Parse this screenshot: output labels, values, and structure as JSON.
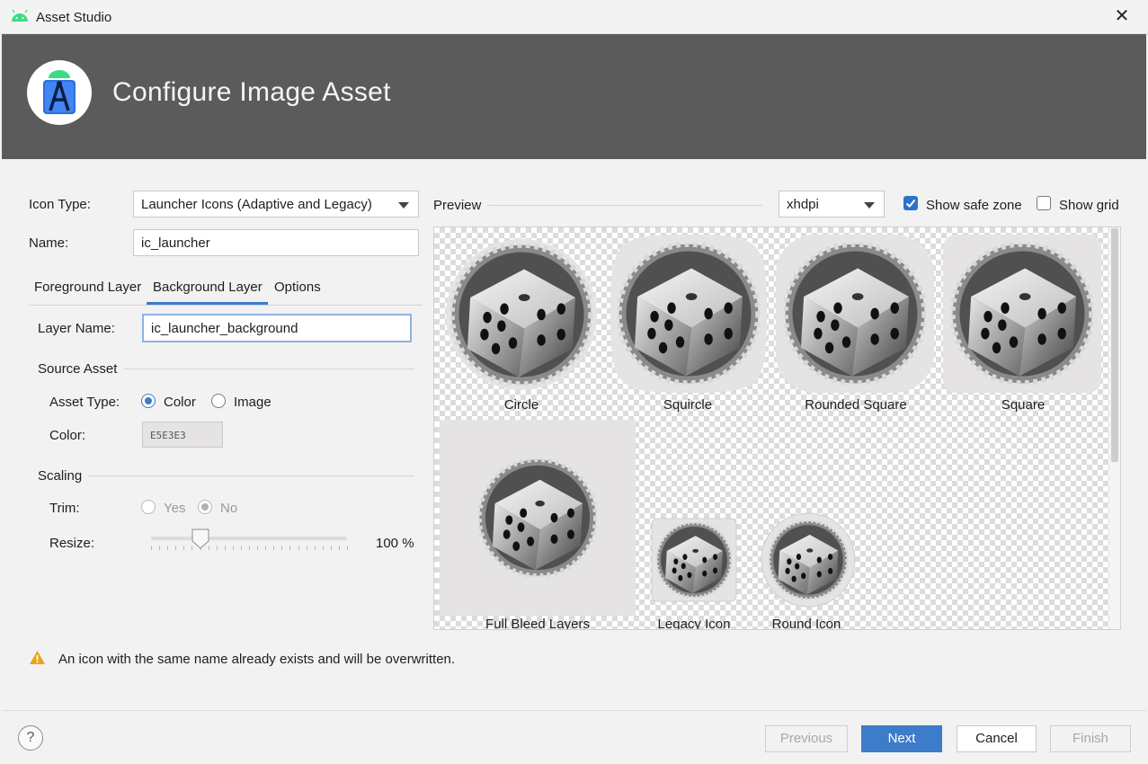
{
  "window": {
    "title": "Asset Studio",
    "close_symbol": "✕"
  },
  "header": {
    "title": "Configure Image Asset"
  },
  "form": {
    "icon_type_label": "Icon Type:",
    "icon_type_value": "Launcher Icons (Adaptive and Legacy)",
    "name_label": "Name:",
    "name_value": "ic_launcher",
    "tabs": [
      "Foreground Layer",
      "Background Layer",
      "Options"
    ],
    "active_tab": "Background Layer",
    "layer_name_label": "Layer Name:",
    "layer_name_value": "ic_launcher_background",
    "source_asset_heading": "Source Asset",
    "asset_type_label": "Asset Type:",
    "asset_type_options": [
      "Color",
      "Image"
    ],
    "asset_type_selected": "Color",
    "color_label": "Color:",
    "color_value": "E5E3E3",
    "scaling_heading": "Scaling",
    "trim_label": "Trim:",
    "trim_options": [
      "Yes",
      "No"
    ],
    "trim_selected": "No",
    "resize_label": "Resize:",
    "resize_value": "100 %",
    "resize_percent": 100
  },
  "preview": {
    "label": "Preview",
    "density_value": "xhdpi",
    "show_safe_zone_label": "Show safe zone",
    "show_safe_zone": true,
    "show_grid_label": "Show grid",
    "show_grid": false,
    "captions": [
      "Circle",
      "Squircle",
      "Rounded Square",
      "Square",
      "Full Bleed Layers",
      "Legacy Icon",
      "Round Icon"
    ]
  },
  "warning": {
    "text": "An icon with the same name already exists and will be overwritten."
  },
  "footer": {
    "help_symbol": "?",
    "previous": "Previous",
    "next": "Next",
    "cancel": "Cancel",
    "finish": "Finish"
  },
  "colors": {
    "accent": "#3d7cc9",
    "header_bg": "#5b5b5b",
    "background_layer": "#E5E3E3",
    "warning": "#e8a317"
  }
}
